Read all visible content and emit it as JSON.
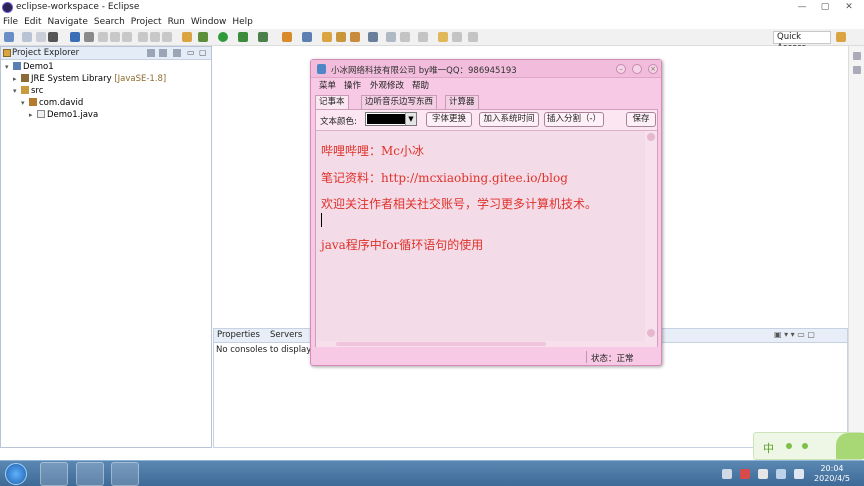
{
  "window": {
    "title": "eclipse-workspace - Eclipse",
    "controls": {
      "minimize": "—",
      "maximize": "▢",
      "close": "✕"
    }
  },
  "menu": [
    "File",
    "Edit",
    "Navigate",
    "Search",
    "Project",
    "Run",
    "Window",
    "Help"
  ],
  "toolbar": {
    "quick_access": "Quick Access"
  },
  "explorer": {
    "tab_label": "Project Explorer",
    "tree": {
      "project": "Demo1",
      "jre": "JRE System Library",
      "jre_suffix": "[JavaSE-1.8]",
      "src": "src",
      "package": "com.david",
      "file": "Demo1.java"
    }
  },
  "console": {
    "tab_properties": "Properties",
    "tab_servers": "Servers",
    "message": "No consoles to display a"
  },
  "app": {
    "title": "小冰网络科技有限公司 by唯一QQ：986945193",
    "menu": [
      "菜单",
      "操作",
      "外观修改",
      "帮助"
    ],
    "tabs": [
      "记事本",
      "边听音乐边写东西",
      "计算器"
    ],
    "color_label": "文本颜色:",
    "color_value": "#000000",
    "buttons": {
      "font": "字体更换",
      "add_time": "加入系统时间",
      "insert_split": "插入分割（-）",
      "save": "保存"
    },
    "text_lines": [
      "哔哩哔哩：Mc小冰",
      "笔记资料：http://mcxiaobing.gitee.io/blog",
      "欢迎关注作者相关社交账号，学习更多计算机技术。",
      "",
      "java程序中for循环语句的使用"
    ],
    "text_color": "#e0322a",
    "status": "状态：正常"
  },
  "ime": {
    "label": "中"
  },
  "taskbar": {
    "time": "20:04",
    "date": "2020/4/5"
  }
}
